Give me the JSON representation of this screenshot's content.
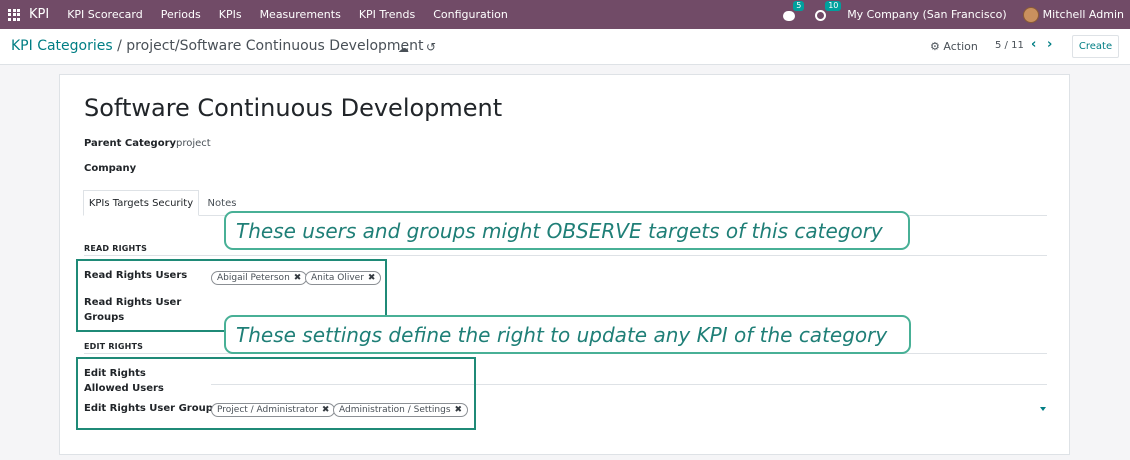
{
  "navbar": {
    "brand": "KPI",
    "menu": [
      "KPI Scorecard",
      "Periods",
      "KPIs",
      "Measurements",
      "KPI Trends",
      "Configuration"
    ],
    "messages_count": "5",
    "activities_count": "10",
    "company": "My Company (San Francisco)",
    "user": "Mitchell Admin"
  },
  "control": {
    "breadcrumb_root": "KPI Categories",
    "breadcrumb_sep": " / ",
    "breadcrumb_current": "project/Software Continuous Development",
    "action_label": "Action",
    "pager": "5 / 11",
    "create_label": "Create"
  },
  "form": {
    "title": "Software Continuous Development",
    "parent_category_label": "Parent Category",
    "parent_category_value": "project",
    "company_label": "Company",
    "tabs": [
      "KPIs Targets Security",
      "Notes"
    ],
    "read_rights_title": "READ RIGHTS",
    "read_users_label": "Read Rights Users",
    "read_users_tags": [
      "Abigail Peterson",
      "Anita Oliver"
    ],
    "read_groups_label": "Read Rights User Groups",
    "edit_rights_title": "EDIT RIGHTS",
    "edit_users_label": "Edit Rights Allowed Users",
    "edit_groups_label": "Edit Rights User Groups",
    "edit_groups_tags": [
      "Project / Administrator",
      "Administration / Settings"
    ]
  },
  "annotations": {
    "read_note": "These users and groups might OBSERVE targets of this category",
    "edit_note": "These settings define the right to update any KPI of the category"
  },
  "icons": {
    "apps": "apps-grid-icon",
    "messages": "chat-icon",
    "activities": "clock-icon",
    "save": "cloud-upload-icon",
    "discard": "undo-icon",
    "action": "gear-icon",
    "tag_remove": "close-icon"
  },
  "colors": {
    "navbar": "#714b67",
    "accent": "#017e84",
    "badge": "#00a09d",
    "annotation": "#1f8a77"
  }
}
